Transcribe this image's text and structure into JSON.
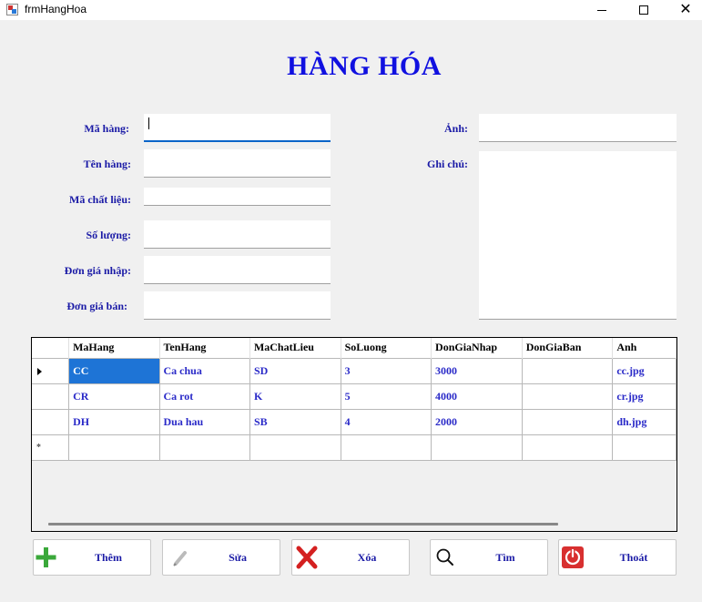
{
  "window": {
    "title": "frmHangHoa"
  },
  "heading": "HÀNG HÓA",
  "form": {
    "ma_hang_label": "Mã hàng:",
    "ten_hang_label": "Tên hàng:",
    "ma_chat_lieu_label": "Mã chất liệu:",
    "so_luong_label": "Số lượng:",
    "don_gia_nhap_label": "Đơn giá nhập:",
    "don_gia_ban_label": "Đơn giá bán:",
    "anh_label": "Ảnh:",
    "ghi_chu_label": "Ghi chú:",
    "ma_hang_value": "",
    "ten_hang_value": "",
    "ma_chat_lieu_value": "",
    "so_luong_value": "",
    "don_gia_nhap_value": "",
    "don_gia_ban_value": "",
    "anh_value": "",
    "ghi_chu_value": ""
  },
  "grid": {
    "columns": [
      "MaHang",
      "TenHang",
      "MaChatLieu",
      "SoLuong",
      "DonGiaNhap",
      "DonGiaBan",
      "Anh"
    ],
    "rows": [
      [
        "CC",
        "Ca chua",
        "SD",
        "3",
        "3000",
        "",
        "cc.jpg"
      ],
      [
        "CR",
        "Ca rot",
        "K",
        "5",
        "4000",
        "",
        "cr.jpg"
      ],
      [
        "DH",
        "Dua hau",
        "SB",
        "4",
        "2000",
        "",
        "dh.jpg"
      ]
    ],
    "new_row_marker": "*"
  },
  "buttons": {
    "them": "Thêm",
    "sua": "Sửa",
    "xoa": "Xóa",
    "tim": "Tìm",
    "thoat": "Thoát"
  },
  "icons": {
    "them": "plus-icon",
    "sua": "pencil-icon",
    "xoa": "delete-x-icon",
    "tim": "search-icon",
    "thoat": "power-icon"
  },
  "colors": {
    "heading": "#1010e0",
    "label": "#1a1aa6",
    "cell_text": "#2a2ac8",
    "selection": "#1e74d6",
    "plus": "#3aa83a",
    "delete": "#d42020",
    "exit": "#d83030"
  }
}
